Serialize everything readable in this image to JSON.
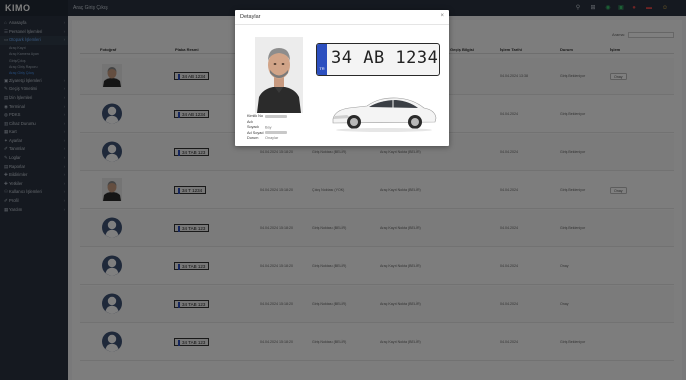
{
  "app": {
    "logo": "KIMO",
    "page_title": "Araç Giriş Çıkış"
  },
  "sidebar": {
    "items": [
      {
        "label": "Anasayfa",
        "icon": "home-icon",
        "glyph": "⌂",
        "active": false,
        "sub": []
      },
      {
        "label": "Personel İşlemleri",
        "icon": "users-icon",
        "glyph": "☰",
        "active": false,
        "sub": []
      },
      {
        "label": "Otopark İşlemleri",
        "icon": "car-icon",
        "glyph": "▭",
        "active": true,
        "sub": [
          "Araç Kayıt",
          "Araç Kamera Ayarı",
          "Giriş/Çıkış",
          "Araç Giriş Raporu",
          "Araç Giriş Çıkış"
        ]
      },
      {
        "label": "Ziyaretçi İşlemleri",
        "icon": "visitor-icon",
        "glyph": "▣",
        "active": false,
        "sub": []
      },
      {
        "label": "Geçiş Yönetimi",
        "icon": "key-icon",
        "glyph": "✎",
        "active": false,
        "sub": []
      },
      {
        "label": "İzin İşlemleri",
        "icon": "calendar-icon",
        "glyph": "▤",
        "active": false,
        "sub": []
      },
      {
        "label": "Terminal",
        "icon": "terminal-icon",
        "glyph": "◉",
        "active": false,
        "sub": []
      },
      {
        "label": "PDKS",
        "icon": "clock-icon",
        "glyph": "◍",
        "active": false,
        "sub": []
      },
      {
        "label": "Cihaz Durumu",
        "icon": "device-icon",
        "glyph": "▥",
        "active": false,
        "sub": []
      },
      {
        "label": "Kart",
        "icon": "card-icon",
        "glyph": "▦",
        "active": false,
        "sub": []
      },
      {
        "label": "Ayarlar",
        "icon": "settings-icon",
        "glyph": "✦",
        "active": false,
        "sub": []
      },
      {
        "label": "Tanımlar",
        "icon": "list-icon",
        "glyph": "✐",
        "active": false,
        "sub": []
      },
      {
        "label": "Loglar",
        "icon": "log-icon",
        "glyph": "✎",
        "active": false,
        "sub": []
      },
      {
        "label": "Raporlar",
        "icon": "report-icon",
        "glyph": "▤",
        "active": false,
        "sub": []
      },
      {
        "label": "Bildirimler",
        "icon": "bell-icon",
        "glyph": "✚",
        "active": false,
        "sub": []
      },
      {
        "label": "Yetkiler",
        "icon": "lock-icon",
        "glyph": "✚",
        "active": false,
        "sub": []
      },
      {
        "label": "Kullanıcı İşlemleri",
        "icon": "user-icon",
        "glyph": "⚇",
        "active": false,
        "sub": []
      },
      {
        "label": "Profil",
        "icon": "profile-icon",
        "glyph": "✐",
        "active": false,
        "sub": []
      },
      {
        "label": "Yardım",
        "icon": "help-icon",
        "glyph": "▦",
        "active": false,
        "sub": []
      }
    ]
  },
  "topbar": {
    "icons": [
      {
        "name": "search-icon",
        "glyph": "⚲",
        "color": "#c9d0da"
      },
      {
        "name": "grid-icon",
        "glyph": "⊞",
        "color": "#c9d0da"
      },
      {
        "name": "status-icon",
        "glyph": "◉",
        "color": "#39c06a"
      },
      {
        "name": "lock-icon",
        "glyph": "▣",
        "color": "#39c06a"
      },
      {
        "name": "alert-icon",
        "glyph": "●",
        "color": "#e04848"
      },
      {
        "name": "flag-icon",
        "glyph": "▬",
        "color": "#e04848"
      },
      {
        "name": "user-avatar-icon",
        "glyph": "☺",
        "color": "#f2c14e"
      }
    ]
  },
  "table": {
    "search_label": "Arama:",
    "columns": [
      "Fotoğraf",
      "Plaka Resmi",
      "Giriş Saati",
      "Çıkış Saati",
      "Otopark",
      "Geçiş Bilgisi",
      "İşlem Tarihi",
      "Durum",
      "İşlem"
    ],
    "rows": [
      {
        "photo": "real",
        "plate": "34 AB 1234",
        "time": "",
        "dir": "",
        "park": "",
        "date": "04.04.2024 13:38",
        "status": "Giriş Bekleniyor",
        "action": "Onay"
      },
      {
        "photo": "default",
        "plate": "34 AB 1234",
        "time": "",
        "dir": "",
        "park": "",
        "date": "04.04.2024",
        "status": "Giriş Bekleniyor",
        "action": ""
      },
      {
        "photo": "default",
        "plate": "34 TAB 123",
        "time": "04.04.2024 15:18:20",
        "dir": "Giriş Noktası (BELİR)",
        "park": "Araç Kayıt Nokta (BELİR)",
        "date": "04.04.2024",
        "status": "Giriş Bekleniyor",
        "action": ""
      },
      {
        "photo": "real",
        "plate": "34 T 1234",
        "time": "04.04.2024 15:18:20",
        "dir": "Çıkış Noktası (YOK)",
        "park": "Araç Kayıt Nokta (BELİR)",
        "date": "04.04.2024",
        "status": "Giriş Bekleniyor",
        "action": "Onay"
      },
      {
        "photo": "default",
        "plate": "34 TAB 123",
        "time": "04.04.2024 15:18:20",
        "dir": "Giriş Noktası (BELİR)",
        "park": "Araç Kayıt Nokta (BELİR)",
        "date": "04.04.2024",
        "status": "Giriş Bekleniyor",
        "action": ""
      },
      {
        "photo": "default",
        "plate": "34 TAB 123",
        "time": "04.04.2024 15:18:20",
        "dir": "Giriş Noktası (BELİR)",
        "park": "Araç Kayıt Nokta (BELİR)",
        "date": "04.04.2024",
        "status": "Onay",
        "action": ""
      },
      {
        "photo": "default",
        "plate": "34 TAB 123",
        "time": "04.04.2024 15:18:20",
        "dir": "Giriş Noktası (BELİR)",
        "park": "Araç Kayıt Nokta (BELİR)",
        "date": "04.04.2024",
        "status": "Onay",
        "action": ""
      },
      {
        "photo": "default",
        "plate": "34 TAB 123",
        "time": "04.04.2024 15:18:20",
        "dir": "Giriş Noktası (BELİR)",
        "park": "Araç Kayıt Nokta (BELİR)",
        "date": "04.04.2024",
        "status": "Giriş Bekleniyor",
        "action": ""
      }
    ]
  },
  "modal": {
    "title": "Detaylar",
    "close": "×",
    "plate": "34 AB 1234",
    "plate_country": "TR",
    "fields": [
      {
        "label": "Kimlik No",
        "value": ""
      },
      {
        "label": "Adı Soyadı",
        "value": "Bay"
      },
      {
        "label": "Ad Soyad",
        "value": ""
      },
      {
        "label": "Durum",
        "value": "Onaylar"
      }
    ]
  }
}
